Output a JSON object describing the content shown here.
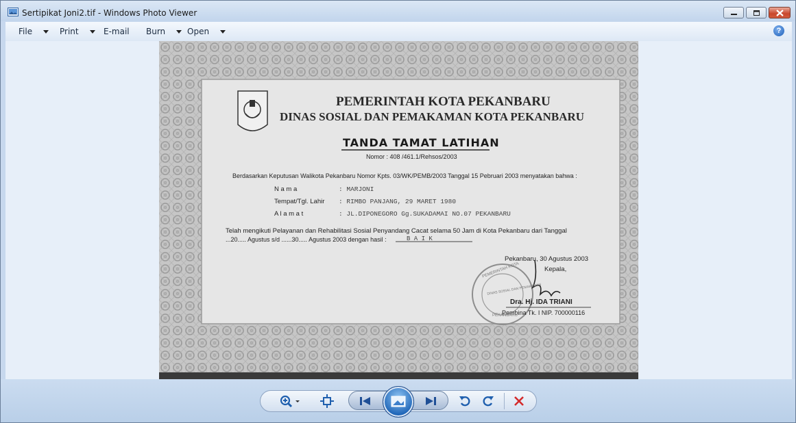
{
  "window": {
    "title": "Sertipikat Joni2.tif - Windows Photo Viewer"
  },
  "menu": {
    "items": [
      {
        "label": "File",
        "has_caret": true
      },
      {
        "label": "Print",
        "has_caret": true
      },
      {
        "label": "E-mail",
        "has_caret": false
      },
      {
        "label": "Burn",
        "has_caret": true
      },
      {
        "label": "Open",
        "has_caret": true
      }
    ],
    "help_icon": "?"
  },
  "certificate": {
    "header_line1": "PEMERINTAH KOTA PEKANBARU",
    "header_line2": "DINAS SOSIAL DAN PEMAKAMAN KOTA PEKANBARU",
    "doc_title": "TANDA TAMAT LATIHAN",
    "nomor": "Nomor : 408 /461.1/Rehsos/2003",
    "intro": "Berdasarkan Keputusan Walikota Pekanbaru Nomor Kpts. 03/WK/PEMB/2003 Tanggal 15 Pebruari 2003 menyatakan bahwa :",
    "fields": [
      {
        "label": "N a m a",
        "value": ": MARJONI"
      },
      {
        "label": "Tempat/Tgl. Lahir",
        "value": ": RIMBO PANJANG, 29 MARET 1980"
      },
      {
        "label": "A l a m a t",
        "value": ": JL.DIPONEGORO Gg.SUKADAMAI NO.07 PEKANBARU"
      }
    ],
    "statement_line1": "Telah mengikuti Pelayanan dan Rehabilitasi Sosial Penyandang Cacat selama 50 Jam di Kota Pekanbaru dari Tanggal",
    "statement_line2_a": "...20..... Agustus s/d ......30..... Agustus 2003 dengan hasil :",
    "statement_result": "B A I K",
    "sign_place_date": "Pekanbaru, 30 Agustus 2003",
    "sign_role": "Kepala,",
    "sign_name": "Dra. Hj. IDA TRIANI",
    "sign_rank": "Pembina Tk. I NIP. 700000116",
    "stamp_outer": "PEMERINTAH KOTA",
    "stamp_inner": "DINAS SOSIAL DAN PEMAKAMAN",
    "stamp_bottom": "PEKANBARU"
  },
  "toolbar": {
    "buttons": [
      "zoom-icon",
      "actual-size-icon",
      "previous-icon",
      "slideshow-icon",
      "next-icon",
      "rotate-ccw-icon",
      "rotate-cw-icon",
      "delete-icon"
    ]
  },
  "colors": {
    "accent_blue": "#1f66b8",
    "delete_red": "#d42b2b",
    "viewport_bg": "#e7eff9"
  }
}
